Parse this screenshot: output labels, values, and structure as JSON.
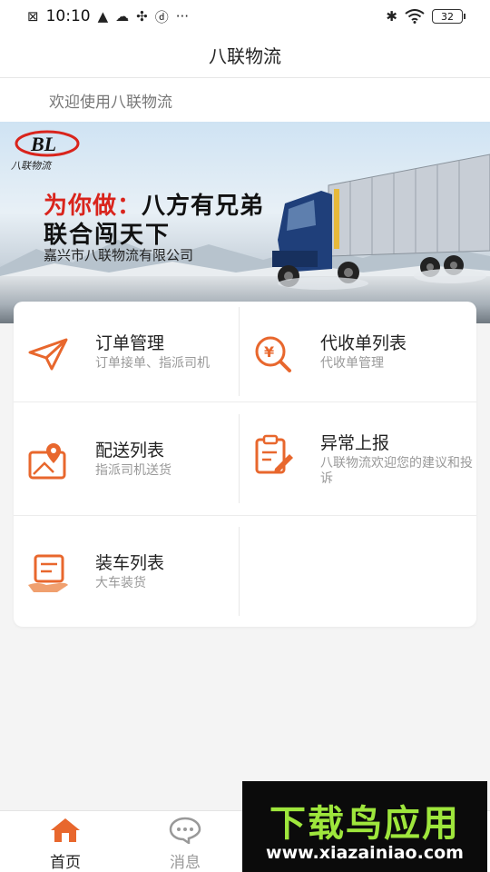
{
  "status_bar": {
    "time": "10:10",
    "battery": "32"
  },
  "header": {
    "title": "八联物流"
  },
  "welcome": {
    "text": "欢迎使用八联物流"
  },
  "banner": {
    "logo_text": "BL",
    "logo_subtitle": "八联物流",
    "slogan_prefix": "为你做：",
    "slogan_rest": "八方有兄弟",
    "slogan_line2": "联合闯天下",
    "company": "嘉兴市八联物流有限公司"
  },
  "menu": {
    "items": [
      {
        "title": "订单管理",
        "subtitle": "订单接单、指派司机",
        "icon": "paper-plane-icon"
      },
      {
        "title": "代收单列表",
        "subtitle": "代收单管理",
        "icon": "yuan-search-icon"
      },
      {
        "title": "配送列表",
        "subtitle": "指派司机送货",
        "icon": "map-pin-icon"
      },
      {
        "title": "异常上报",
        "subtitle": "八联物流欢迎您的建议和投诉",
        "icon": "clipboard-edit-icon"
      },
      {
        "title": "装车列表",
        "subtitle": "大车装货",
        "icon": "hand-list-icon"
      }
    ]
  },
  "bottom_nav": {
    "items": [
      {
        "label": "首页",
        "icon": "home-icon",
        "active": true
      },
      {
        "label": "消息",
        "icon": "chat-icon",
        "active": false
      }
    ]
  },
  "watermark": {
    "title": "下载鸟应用",
    "url": "www.xiazainiao.com"
  },
  "colors": {
    "accent": "#e8672d",
    "inactive": "#999999"
  }
}
